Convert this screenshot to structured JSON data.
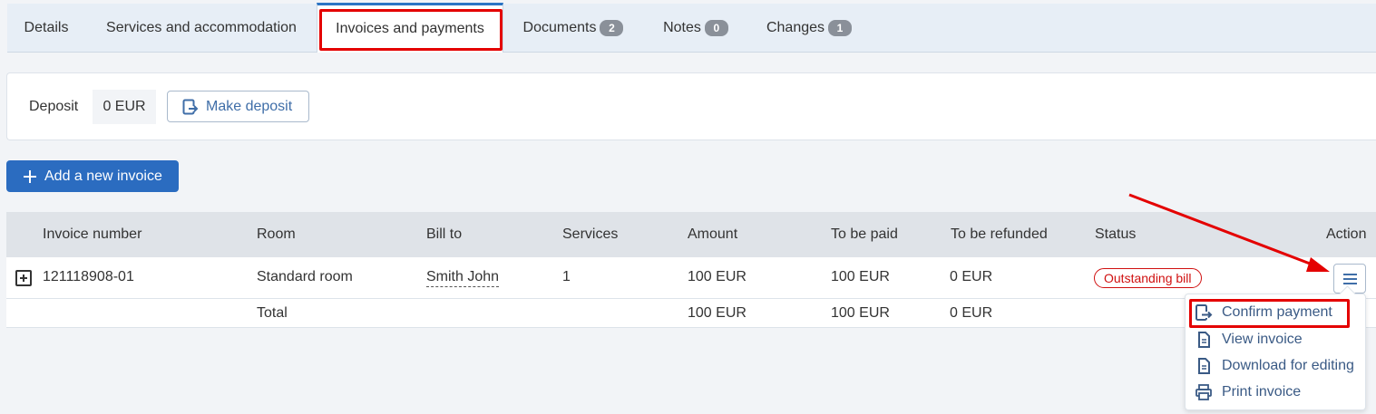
{
  "tabs": [
    {
      "label": "Details"
    },
    {
      "label": "Services and accommodation"
    },
    {
      "label": "Invoices and payments"
    },
    {
      "label": "Documents",
      "count": "2"
    },
    {
      "label": "Notes",
      "count": "0"
    },
    {
      "label": "Changes",
      "count": "1"
    }
  ],
  "deposit": {
    "label": "Deposit",
    "value": "0 EUR",
    "make_deposit_label": "Make deposit"
  },
  "add_invoice_label": "Add a new invoice",
  "table": {
    "headers": [
      "Invoice number",
      "Room",
      "Bill to",
      "Services",
      "Amount",
      "To be paid",
      "To be refunded",
      "Status",
      "Action"
    ],
    "rows": [
      {
        "invoice_number": "121118908-01",
        "room": "Standard room",
        "bill_to": "Smith John",
        "services": "1",
        "amount": "100 EUR",
        "to_be_paid": "100 EUR",
        "to_be_refunded": "0 EUR",
        "status": "Outstanding bill"
      }
    ],
    "total": {
      "label": "Total",
      "amount": "100 EUR",
      "to_be_paid": "100 EUR",
      "to_be_refunded": "0 EUR"
    }
  },
  "action_menu": {
    "items": [
      {
        "label": "Confirm payment",
        "icon": "confirm-payment-icon"
      },
      {
        "label": "View invoice",
        "icon": "document-icon"
      },
      {
        "label": "Download for editing",
        "icon": "document-icon"
      },
      {
        "label": "Print invoice",
        "icon": "printer-icon"
      }
    ]
  },
  "colors": {
    "accent": "#2b6cc0",
    "highlight": "#e40000",
    "status_outstanding": "#d01010",
    "link": "#3f6ea8"
  }
}
